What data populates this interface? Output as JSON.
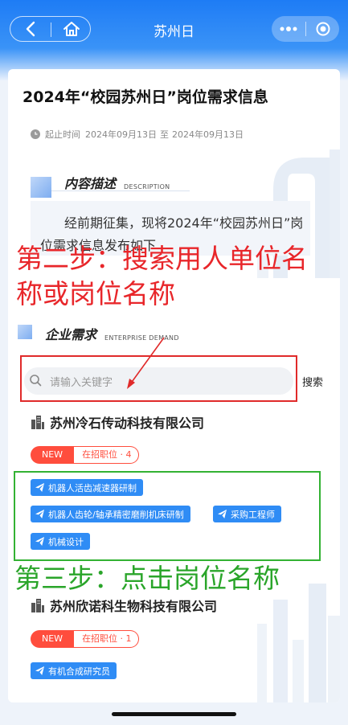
{
  "header": {
    "title": "苏州日",
    "back_icon": "chevron-left-icon",
    "home_icon": "home-icon",
    "more_icon": "more-dots-icon",
    "close_icon": "target-close-icon"
  },
  "article": {
    "title": "2024年“校园苏州日”岗位需求信息",
    "date_label": "起止时间",
    "start_date": "2024年09月13日",
    "date_sep": "至",
    "end_date": "2024年09月13日"
  },
  "sections": {
    "description": {
      "title": "内容描述",
      "subtitle": "DESCRIPTION",
      "text": "经前期征集，现将2024年“校园苏州日”岗位需求信息发布如下"
    },
    "demand": {
      "title": "企业需求",
      "subtitle": "ENTERPRISE DEMAND"
    }
  },
  "search": {
    "placeholder": "请输入关键字",
    "button": "搜索"
  },
  "companies": [
    {
      "name": "苏州冷石传动科技有限公司",
      "badge_new": "NEW",
      "badge_count": "在招职位 · 4",
      "jobs": [
        "机器人活齿减速器研制",
        "机器人齿轮/轴承精密磨削机床研制",
        "采购工程师",
        "机械设计"
      ]
    },
    {
      "name": "苏州欣诺科生物科技有限公司",
      "badge_new": "NEW",
      "badge_count": "在招职位 · 1",
      "jobs": [
        "有机合成研究员"
      ]
    }
  ],
  "annotations": {
    "step2": "第二步：搜索用人单位名称或岗位名称",
    "step3": "第三步：点击岗位名称"
  },
  "colors": {
    "brand_blue": "#2f8cf5",
    "badge_red": "#ff4d3d",
    "anno_red": "#e8262a",
    "anno_green": "#2aa52a"
  }
}
